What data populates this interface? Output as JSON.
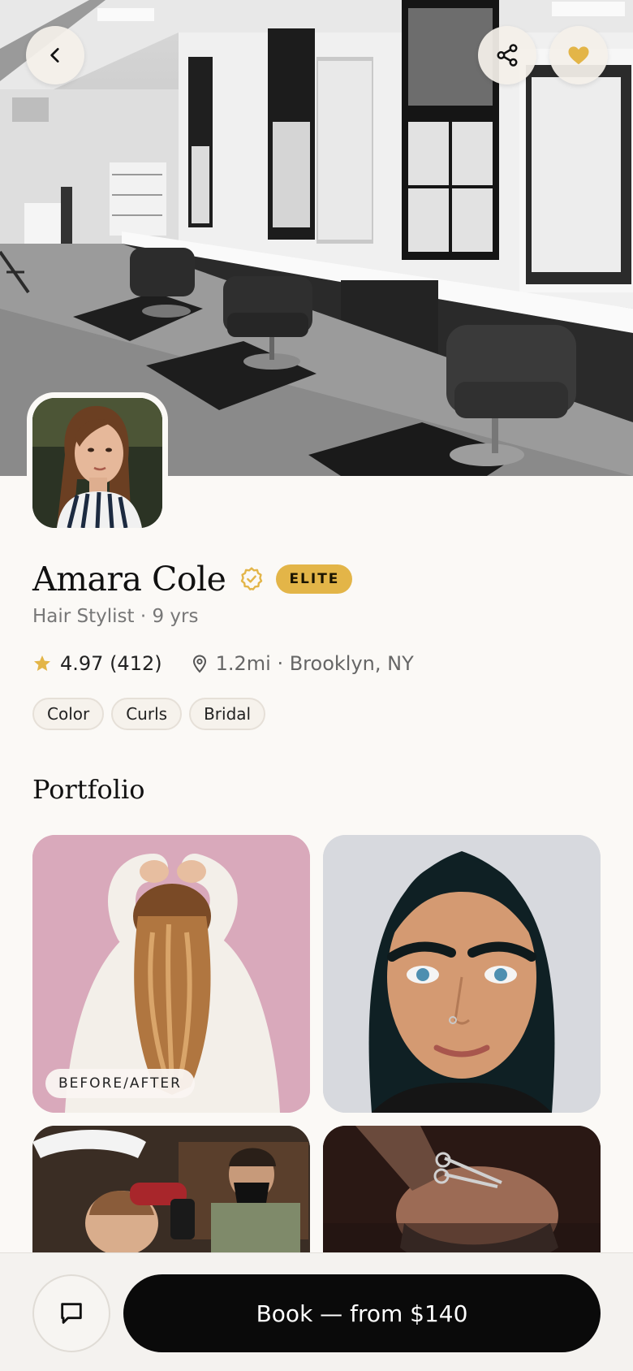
{
  "profile": {
    "name": "Amara Cole",
    "badge": "ELITE",
    "role": "Hair Stylist · 9 yrs",
    "rating": "4.97 (412)",
    "location": "1.2mi · Brooklyn, NY",
    "tags": [
      "Color",
      "Curls",
      "Bridal"
    ]
  },
  "portfolio": {
    "title": "Portfolio",
    "tile1_label": "BEFORE/AFTER"
  },
  "actions": {
    "book_label": "Book — from $140"
  },
  "icons": {
    "back": "chevron-left-icon",
    "share": "share-icon",
    "favorite": "heart-icon",
    "verified": "verified-badge-icon",
    "rating": "star-icon",
    "location": "map-pin-icon",
    "message": "chat-bubble-icon"
  },
  "colors": {
    "accent_gold": "#E3B548",
    "background": "#FBF9F6",
    "primary_button": "#0a0a0a"
  }
}
